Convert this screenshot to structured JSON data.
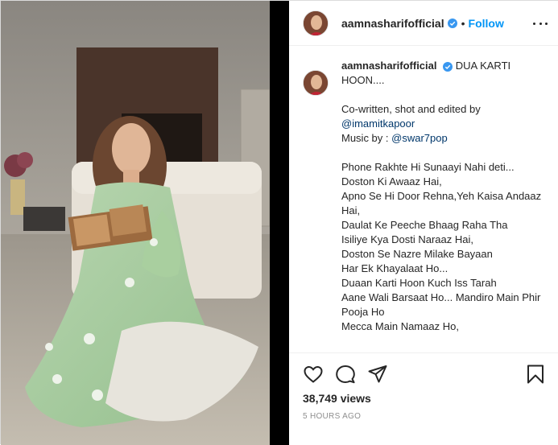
{
  "post": {
    "username": "aamnasharifofficial",
    "follow_label": "Follow",
    "separator": "•",
    "caption_title": "DUA KARTI HOON....",
    "credits_line": "Co-written, shot and edited by",
    "credit_mention": "@imamitkapoor",
    "music_prefix": "Music by : ",
    "music_mention": "@swar7pop",
    "lyrics": [
      "Phone Rakhte Hi Sunaayi Nahi deti...",
      "Doston Ki Awaaz Hai,",
      "Apno Se Hi Door Rehna,Yeh Kaisa Andaaz Hai,",
      "Daulat Ke Peeche Bhaag Raha Tha",
      "Isiliye Kya Dosti Naraaz Hai,",
      "Doston Se Nazre Milake Bayaan",
      "Har Ek Khayalaat Ho...",
      "Duaan Karti Hoon Kuch Iss Tarah",
      "Aane Wali Barsaat Ho... Mandiro Main Phir Pooja Ho",
      "Mecca Main Namaaz Ho,"
    ],
    "views": "38,749 views",
    "time_ago": "5 HOURS AGO"
  },
  "colors": {
    "accent": "#0095f6",
    "mention": "#00376b",
    "verified": "#3897f0",
    "muted": "#8e8e8e"
  },
  "icons": [
    "verified-badge-icon",
    "more-options-icon",
    "heart-icon",
    "comment-icon",
    "share-icon",
    "bookmark-icon"
  ]
}
